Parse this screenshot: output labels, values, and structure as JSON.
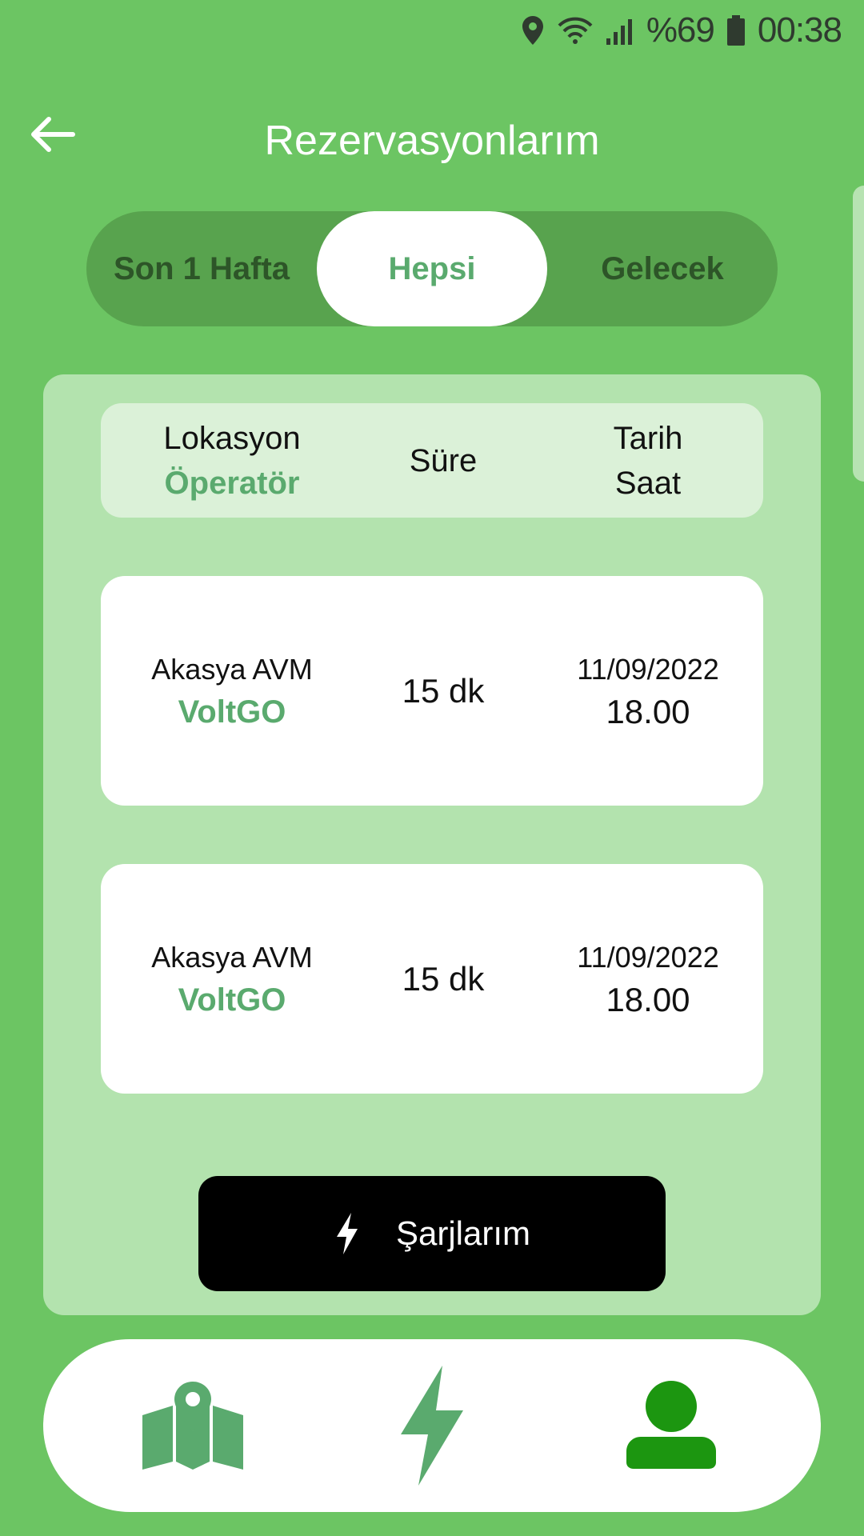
{
  "status_bar": {
    "battery_text": "%69",
    "time": "00:38"
  },
  "header": {
    "title": "Rezervasyonlarım"
  },
  "tabs": [
    {
      "label": "Son 1 Hafta",
      "active": false
    },
    {
      "label": "Hepsi",
      "active": true
    },
    {
      "label": "Gelecek",
      "active": false
    }
  ],
  "table": {
    "header": {
      "location": "Lokasyon",
      "operator": "Öperatör",
      "duration": "Süre",
      "date": "Tarih",
      "time": "Saat"
    },
    "rows": [
      {
        "location": "Akasya AVM",
        "operator": "VoltGO",
        "duration": "15 dk",
        "date": "11/09/2022",
        "time": "18.00"
      },
      {
        "location": "Akasya AVM",
        "operator": "VoltGO",
        "duration": "15 dk",
        "date": "11/09/2022",
        "time": "18.00"
      }
    ]
  },
  "charges_button": {
    "label": "Şarjlarım"
  },
  "colors": {
    "background": "#6cc563",
    "accent": "#5aaa6e",
    "profile_active": "#1c9610"
  }
}
